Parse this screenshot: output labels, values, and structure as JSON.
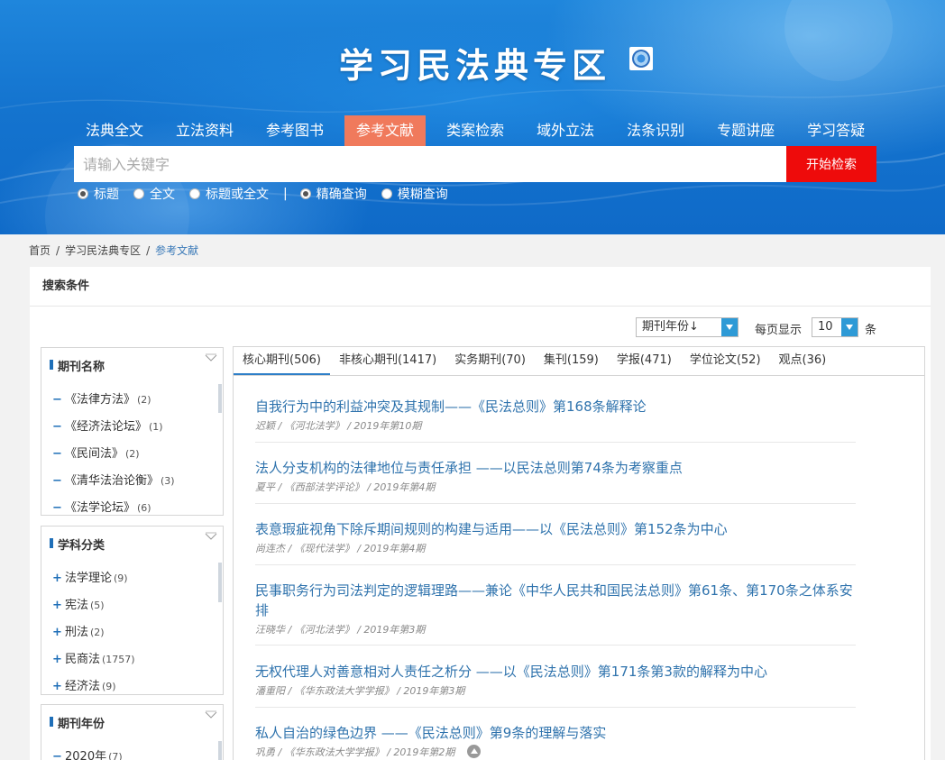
{
  "header": {
    "site_title": "学习民法典专区",
    "nav": [
      {
        "label": "法典全文",
        "active": false
      },
      {
        "label": "立法资料",
        "active": false
      },
      {
        "label": "参考图书",
        "active": false
      },
      {
        "label": "参考文献",
        "active": true
      },
      {
        "label": "类案检索",
        "active": false
      },
      {
        "label": "域外立法",
        "active": false
      },
      {
        "label": "法条识别",
        "active": false
      },
      {
        "label": "专题讲座",
        "active": false
      },
      {
        "label": "学习答疑",
        "active": false
      }
    ],
    "search": {
      "placeholder": "请输入关键字",
      "button_label": "开始检索",
      "scope_options": [
        {
          "label": "标题",
          "checked": true
        },
        {
          "label": "全文",
          "checked": false
        },
        {
          "label": "标题或全文",
          "checked": false
        }
      ],
      "separator": "|",
      "match_options": [
        {
          "label": "精确查询",
          "checked": true
        },
        {
          "label": "模糊查询",
          "checked": false
        }
      ]
    }
  },
  "breadcrumb": [
    "首页",
    "学习民法典专区",
    "参考文献"
  ],
  "panel": {
    "title": "搜索条件",
    "sort_label": "期刊年份↓",
    "per_page_label": "每页显示",
    "per_page_value": "10",
    "per_page_unit": "条"
  },
  "facets": [
    {
      "title": "期刊名称",
      "items": [
        {
          "marker": "−",
          "label": "《法律方法》",
          "count": "(2)"
        },
        {
          "marker": "−",
          "label": "《经济法论坛》",
          "count": "(1)"
        },
        {
          "marker": "−",
          "label": "《民间法》",
          "count": "(2)"
        },
        {
          "marker": "−",
          "label": "《清华法治论衡》",
          "count": "(3)"
        },
        {
          "marker": "−",
          "label": "《法学论坛》",
          "count": "(6)"
        }
      ]
    },
    {
      "title": "学科分类",
      "items": [
        {
          "marker": "+",
          "label": "法学理论",
          "count": "(9)"
        },
        {
          "marker": "+",
          "label": "宪法",
          "count": "(5)"
        },
        {
          "marker": "+",
          "label": "刑法",
          "count": "(2)"
        },
        {
          "marker": "+",
          "label": "民商法",
          "count": "(1757)"
        },
        {
          "marker": "+",
          "label": "经济法",
          "count": "(9)"
        }
      ]
    },
    {
      "title": "期刊年份",
      "items": [
        {
          "marker": "−",
          "label": "2020年",
          "count": "(7)"
        }
      ]
    }
  ],
  "tabs": [
    {
      "label": "核心期刊(506)",
      "active": true
    },
    {
      "label": "非核心期刊(1417)",
      "active": false
    },
    {
      "label": "实务期刊(70)",
      "active": false
    },
    {
      "label": "集刊(159)",
      "active": false
    },
    {
      "label": "学报(471)",
      "active": false
    },
    {
      "label": "学位论文(52)",
      "active": false
    },
    {
      "label": "观点(36)",
      "active": false
    }
  ],
  "articles": [
    {
      "title": "自我行为中的利益冲突及其规制——《民法总则》第168条解释论",
      "meta": "迟颖 / 《河北法学》 / 2019年第10期"
    },
    {
      "title": "法人分支机构的法律地位与责任承担 ——以民法总则第74条为考察重点",
      "meta": "夏平 / 《西部法学评论》 / 2019年第4期"
    },
    {
      "title": "表意瑕疵视角下除斥期间规则的构建与适用——以《民法总则》第152条为中心",
      "meta": "尚连杰 / 《现代法学》 / 2019年第4期"
    },
    {
      "title": "民事职务行为司法判定的逻辑理路——兼论《中华人民共和国民法总则》第61条、第170条之体系安排",
      "meta": "汪晓华 / 《河北法学》 / 2019年第3期"
    },
    {
      "title": "无权代理人对善意相对人责任之析分 ——以《民法总则》第171条第3款的解释为中心",
      "meta": "潘重阳 / 《华东政法大学学报》 / 2019年第3期"
    },
    {
      "title": "私人自治的绿色边界 ——《民法总则》第9条的理解与落实",
      "meta": "巩勇 / 《华东政法大学学报》 / 2019年第2期"
    }
  ]
}
